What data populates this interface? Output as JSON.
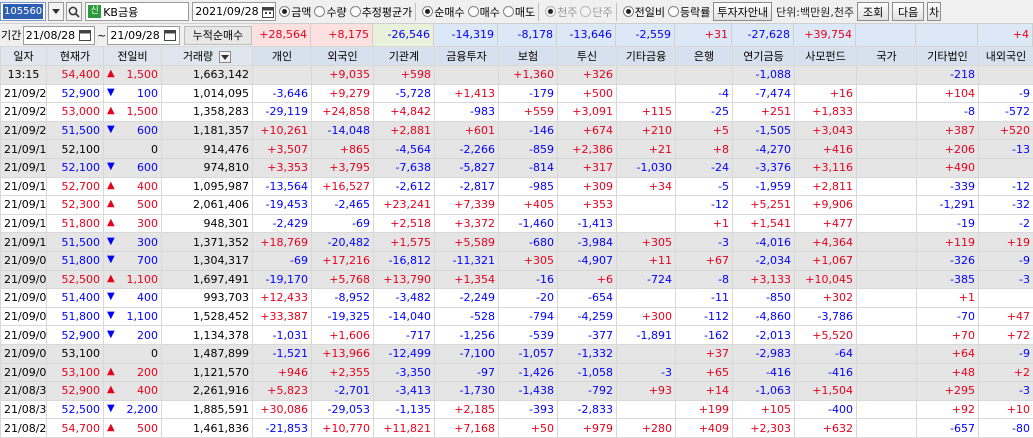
{
  "toolbar": {
    "code": "105560",
    "stock_badge": "신",
    "stock_name": "KB금융",
    "date": "2021/09/28",
    "radios_a": [
      {
        "label": "금액",
        "on": true,
        "dis": false
      },
      {
        "label": "수량",
        "on": false,
        "dis": false
      },
      {
        "label": "추정평균가",
        "on": false,
        "dis": false
      }
    ],
    "radios_b": [
      {
        "label": "순매수",
        "on": true,
        "dis": false
      },
      {
        "label": "매수",
        "on": false,
        "dis": false
      },
      {
        "label": "매도",
        "on": false,
        "dis": false
      }
    ],
    "radios_c": [
      {
        "label": "천주",
        "on": true,
        "dis": true
      },
      {
        "label": "단주",
        "on": false,
        "dis": true
      }
    ],
    "radios_d": [
      {
        "label": "전일비",
        "on": true,
        "dis": false
      },
      {
        "label": "등락률",
        "on": false,
        "dis": false
      }
    ],
    "investor_guide_button": "투자자안내",
    "unit_label": "단위:백만원,천주",
    "search_button": "조회",
    "next_button": "다음",
    "extra_button": "차"
  },
  "period": {
    "label": "기간",
    "start": "21/08/28",
    "tilde": "~",
    "end": "21/09/28",
    "cumulative_label": "누적순매수",
    "totals": [
      "+28,564",
      "+8,175",
      "-26,546",
      "-14,319",
      "-8,178",
      "-13,646",
      "-2,559",
      "+31",
      "-27,628",
      "+39,754",
      "",
      "",
      "+4"
    ]
  },
  "columns": [
    "일자",
    "현재가",
    "전일비",
    "거래량",
    "개인",
    "외국인",
    "기관계",
    "금융투자",
    "보험",
    "투신",
    "기타금융",
    "은행",
    "연기금등",
    "사모펀드",
    "국가",
    "기타법인",
    "내외국인"
  ],
  "rows": [
    [
      "13:15",
      "54,400",
      "up",
      "1,500",
      "1,663,142",
      "",
      "+9,035",
      "+598",
      "",
      "+1,360",
      "+326",
      "",
      "",
      "-1,088",
      "",
      "",
      "-218",
      ""
    ],
    [
      "21/09/27",
      "52,900",
      "dn",
      "100",
      "1,014,095",
      "-3,646",
      "+9,279",
      "-5,728",
      "+1,413",
      "-179",
      "+500",
      "",
      "-4",
      "-7,474",
      "+16",
      "",
      "+104",
      "-9"
    ],
    [
      "21/09/24",
      "53,000",
      "up",
      "1,500",
      "1,358,283",
      "-29,119",
      "+24,858",
      "+4,842",
      "-983",
      "+559",
      "+3,091",
      "+115",
      "-25",
      "+251",
      "+1,833",
      "",
      "-8",
      "-572"
    ],
    [
      "21/09/23",
      "51,500",
      "dn",
      "600",
      "1,181,357",
      "+10,261",
      "-14,048",
      "+2,881",
      "+601",
      "-146",
      "+674",
      "+210",
      "+5",
      "-1,505",
      "+3,043",
      "",
      "+387",
      "+520"
    ],
    [
      "21/09/17",
      "52,100",
      "flat",
      "0",
      "914,476",
      "+3,507",
      "+865",
      "-4,564",
      "-2,266",
      "-859",
      "+2,386",
      "+21",
      "+8",
      "-4,270",
      "+416",
      "",
      "+206",
      "-13"
    ],
    [
      "21/09/16",
      "52,100",
      "dn",
      "600",
      "974,810",
      "+3,353",
      "+3,795",
      "-7,638",
      "-5,827",
      "-814",
      "+317",
      "-1,030",
      "-24",
      "-3,376",
      "+3,116",
      "",
      "+490",
      ""
    ],
    [
      "21/09/15",
      "52,700",
      "up",
      "400",
      "1,095,987",
      "-13,564",
      "+16,527",
      "-2,612",
      "-2,817",
      "-985",
      "+309",
      "+34",
      "-5",
      "-1,959",
      "+2,811",
      "",
      "-339",
      "-12"
    ],
    [
      "21/09/14",
      "52,300",
      "up",
      "500",
      "2,061,406",
      "-19,453",
      "-2,465",
      "+23,241",
      "+7,339",
      "+405",
      "+353",
      "",
      "-12",
      "+5,251",
      "+9,906",
      "",
      "-1,291",
      "-32"
    ],
    [
      "21/09/13",
      "51,800",
      "up",
      "300",
      "948,301",
      "-2,429",
      "-69",
      "+2,518",
      "+3,372",
      "-1,460",
      "-1,413",
      "",
      "+1",
      "+1,541",
      "+477",
      "",
      "-19",
      "-2"
    ],
    [
      "21/09/10",
      "51,500",
      "dn",
      "300",
      "1,371,352",
      "+18,769",
      "-20,482",
      "+1,575",
      "+5,589",
      "-680",
      "-3,984",
      "+305",
      "-3",
      "-4,016",
      "+4,364",
      "",
      "+119",
      "+19"
    ],
    [
      "21/09/09",
      "51,800",
      "dn",
      "700",
      "1,304,317",
      "-69",
      "+17,216",
      "-16,812",
      "-11,321",
      "+305",
      "-4,907",
      "+11",
      "+67",
      "-2,034",
      "+1,067",
      "",
      "-326",
      "-9"
    ],
    [
      "21/09/08",
      "52,500",
      "up",
      "1,100",
      "1,697,491",
      "-19,170",
      "+5,768",
      "+13,790",
      "+1,354",
      "-16",
      "+6",
      "-724",
      "-8",
      "+3,133",
      "+10,045",
      "",
      "-385",
      "-3"
    ],
    [
      "21/09/07",
      "51,400",
      "dn",
      "400",
      "993,703",
      "+12,433",
      "-8,952",
      "-3,482",
      "-2,249",
      "-20",
      "-654",
      "",
      "-11",
      "-850",
      "+302",
      "",
      "+1",
      ""
    ],
    [
      "21/09/06",
      "51,800",
      "dn",
      "1,100",
      "1,528,452",
      "+33,387",
      "-19,325",
      "-14,040",
      "-528",
      "-794",
      "-4,259",
      "+300",
      "-112",
      "-4,860",
      "-3,786",
      "",
      "-70",
      "+47"
    ],
    [
      "21/09/03",
      "52,900",
      "dn",
      "200",
      "1,134,378",
      "-1,031",
      "+1,606",
      "-717",
      "-1,256",
      "-539",
      "-377",
      "-1,891",
      "-162",
      "-2,013",
      "+5,520",
      "",
      "+70",
      "+72"
    ],
    [
      "21/09/02",
      "53,100",
      "flat",
      "0",
      "1,487,899",
      "-1,521",
      "+13,966",
      "-12,499",
      "-7,100",
      "-1,057",
      "-1,332",
      "",
      "+37",
      "-2,983",
      "-64",
      "",
      "+64",
      "-9"
    ],
    [
      "21/09/01",
      "53,100",
      "up",
      "200",
      "1,121,570",
      "+946",
      "+2,355",
      "-3,350",
      "-97",
      "-1,426",
      "-1,058",
      "-3",
      "+65",
      "-416",
      "-416",
      "",
      "+48",
      "+2"
    ],
    [
      "21/08/31",
      "52,900",
      "up",
      "400",
      "2,261,916",
      "+5,823",
      "-2,701",
      "-3,413",
      "-1,730",
      "-1,438",
      "-792",
      "+93",
      "+14",
      "-1,063",
      "+1,504",
      "",
      "+295",
      "-3"
    ],
    [
      "21/08/30",
      "52,500",
      "dn",
      "2,200",
      "1,885,591",
      "+30,086",
      "-29,053",
      "-1,135",
      "+2,185",
      "-393",
      "-2,833",
      "",
      "+199",
      "+105",
      "-400",
      "",
      "+92",
      "+10"
    ],
    [
      "21/08/27",
      "54,700",
      "up",
      "500",
      "1,461,836",
      "-21,853",
      "+10,770",
      "+11,821",
      "+7,168",
      "+50",
      "+979",
      "+280",
      "+409",
      "+2,303",
      "+632",
      "",
      "-657",
      "-80"
    ]
  ],
  "colors": {
    "up": "#e8001c",
    "down": "#0000ff",
    "code_bg": "#2f5fb3",
    "header_bg": "#dfe6ee",
    "gray_row": "#e5e5e5"
  }
}
